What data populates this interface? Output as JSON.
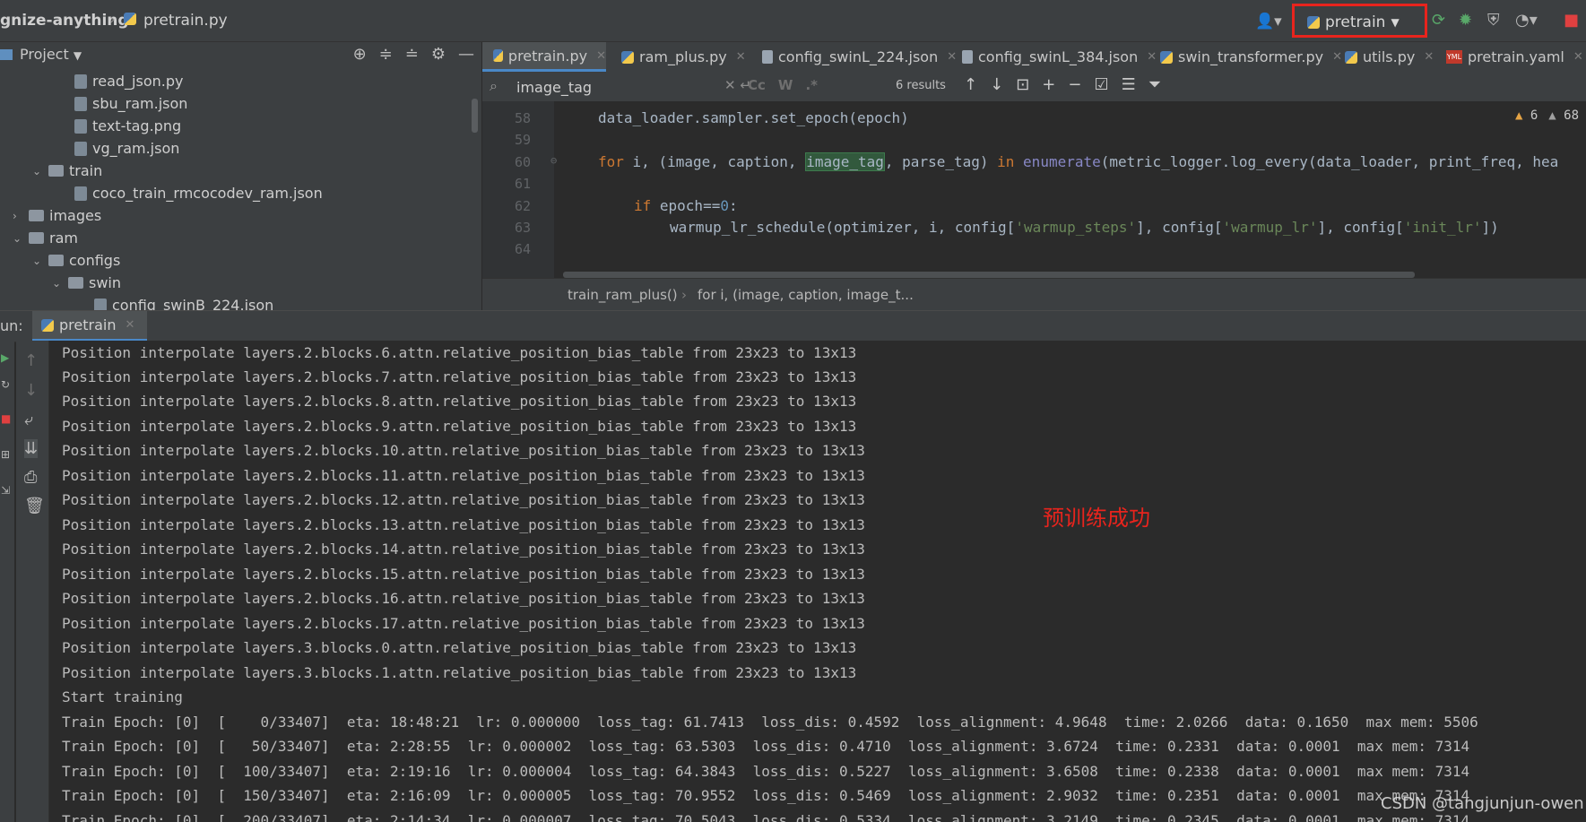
{
  "topbar": {
    "project": "gnize-anything",
    "separator": "›",
    "file": "pretrain.py",
    "run_config": "pretrain"
  },
  "project_panel": {
    "title": "Project",
    "tree": [
      {
        "label": "read_json.py",
        "type": "file"
      },
      {
        "label": "sbu_ram.json",
        "type": "file"
      },
      {
        "label": "text-tag.png",
        "type": "file"
      },
      {
        "label": "vg_ram.json",
        "type": "file"
      },
      {
        "label": "train",
        "type": "folder",
        "expanded": true
      },
      {
        "label": "coco_train_rmcocodev_ram.json",
        "type": "file"
      },
      {
        "label": "images",
        "type": "folder",
        "expanded": false
      },
      {
        "label": "ram",
        "type": "folder",
        "expanded": true
      },
      {
        "label": "configs",
        "type": "folder",
        "expanded": true
      },
      {
        "label": "swin",
        "type": "folder",
        "expanded": true
      },
      {
        "label": "config_swinB_224.json",
        "type": "file"
      }
    ]
  },
  "tabs": [
    {
      "label": "pretrain.py",
      "icon": "python-icon",
      "active": true
    },
    {
      "label": "ram_plus.py",
      "icon": "python-icon"
    },
    {
      "label": "config_swinL_224.json",
      "icon": "json-icon"
    },
    {
      "label": "config_swinL_384.json",
      "icon": "json-icon"
    },
    {
      "label": "swin_transformer.py",
      "icon": "python-icon"
    },
    {
      "label": "utils.py",
      "icon": "python-icon"
    },
    {
      "label": "pretrain.yaml",
      "icon": "yaml-icon"
    }
  ],
  "find": {
    "value": "image_tag",
    "opt_case": "Cc",
    "opt_word": "W",
    "opt_regex": ".*",
    "results": "6 results"
  },
  "editor": {
    "line_numbers": [
      "58",
      "59",
      "60",
      "61",
      "62",
      "63",
      "64"
    ],
    "warnings": "6",
    "weak_warnings": "68",
    "lines": {
      "l58": "data_loader.sampler.set_epoch(epoch)",
      "l60_kw1": "for",
      "l60_a": " i, (image, caption, ",
      "l60_hl": "image_tag",
      "l60_b": ", parse_tag) ",
      "l60_kw2": "in",
      "l60_fn": "enumerate",
      "l60_c": "(metric_logger.log_every(data_loader, print_freq, hea",
      "l62_kw": "if",
      "l62_a": " epoch==",
      "l62_num": "0",
      "l62_b": ":",
      "l63_a": "warmup_lr_schedule(optimizer, i, config[",
      "l63_s1": "'warmup_steps'",
      "l63_b": "], config[",
      "l63_s2": "'warmup_lr'",
      "l63_c": "], config[",
      "l63_s3": "'init_lr'",
      "l63_d": "])"
    }
  },
  "breadcrumb": {
    "item1": "train_ram_plus()",
    "sep": "›",
    "item2": "for i, (image, caption, image_t..."
  },
  "run": {
    "label": "un:",
    "tab": "pretrain"
  },
  "console": [
    "Position interpolate layers.2.blocks.6.attn.relative_position_bias_table from 23x23 to 13x13",
    "Position interpolate layers.2.blocks.7.attn.relative_position_bias_table from 23x23 to 13x13",
    "Position interpolate layers.2.blocks.8.attn.relative_position_bias_table from 23x23 to 13x13",
    "Position interpolate layers.2.blocks.9.attn.relative_position_bias_table from 23x23 to 13x13",
    "Position interpolate layers.2.blocks.10.attn.relative_position_bias_table from 23x23 to 13x13",
    "Position interpolate layers.2.blocks.11.attn.relative_position_bias_table from 23x23 to 13x13",
    "Position interpolate layers.2.blocks.12.attn.relative_position_bias_table from 23x23 to 13x13",
    "Position interpolate layers.2.blocks.13.attn.relative_position_bias_table from 23x23 to 13x13",
    "Position interpolate layers.2.blocks.14.attn.relative_position_bias_table from 23x23 to 13x13",
    "Position interpolate layers.2.blocks.15.attn.relative_position_bias_table from 23x23 to 13x13",
    "Position interpolate layers.2.blocks.16.attn.relative_position_bias_table from 23x23 to 13x13",
    "Position interpolate layers.2.blocks.17.attn.relative_position_bias_table from 23x23 to 13x13",
    "Position interpolate layers.3.blocks.0.attn.relative_position_bias_table from 23x23 to 13x13",
    "Position interpolate layers.3.blocks.1.attn.relative_position_bias_table from 23x23 to 13x13",
    "Start training",
    "Train Epoch: [0]  [    0/33407]  eta: 18:48:21  lr: 0.000000  loss_tag: 61.7413  loss_dis: 0.4592  loss_alignment: 4.9648  time: 2.0266  data: 0.1650  max mem: 5506",
    "Train Epoch: [0]  [   50/33407]  eta: 2:28:55  lr: 0.000002  loss_tag: 63.5303  loss_dis: 0.4710  loss_alignment: 3.6724  time: 0.2331  data: 0.0001  max mem: 7314",
    "Train Epoch: [0]  [  100/33407]  eta: 2:19:16  lr: 0.000004  loss_tag: 64.3843  loss_dis: 0.5227  loss_alignment: 3.6508  time: 0.2338  data: 0.0001  max mem: 7314",
    "Train Epoch: [0]  [  150/33407]  eta: 2:16:09  lr: 0.000005  loss_tag: 70.9552  loss_dis: 0.5469  loss_alignment: 2.9032  time: 0.2351  data: 0.0001  max mem: 7314",
    "Train Epoch: [0]  [  200/33407]  eta: 2:14:34  lr: 0.000007  loss_tag: 70.5043  loss_dis: 0.5334  loss_alignment: 3.2149  time: 0.2345  data: 0.0001  max mem: 7314"
  ],
  "annotation": "预训练成功",
  "watermark": "CSDN @tangjunjun-owen",
  "colors": {
    "highlight_box": "#e8241d",
    "accent": "#4a88c7"
  }
}
